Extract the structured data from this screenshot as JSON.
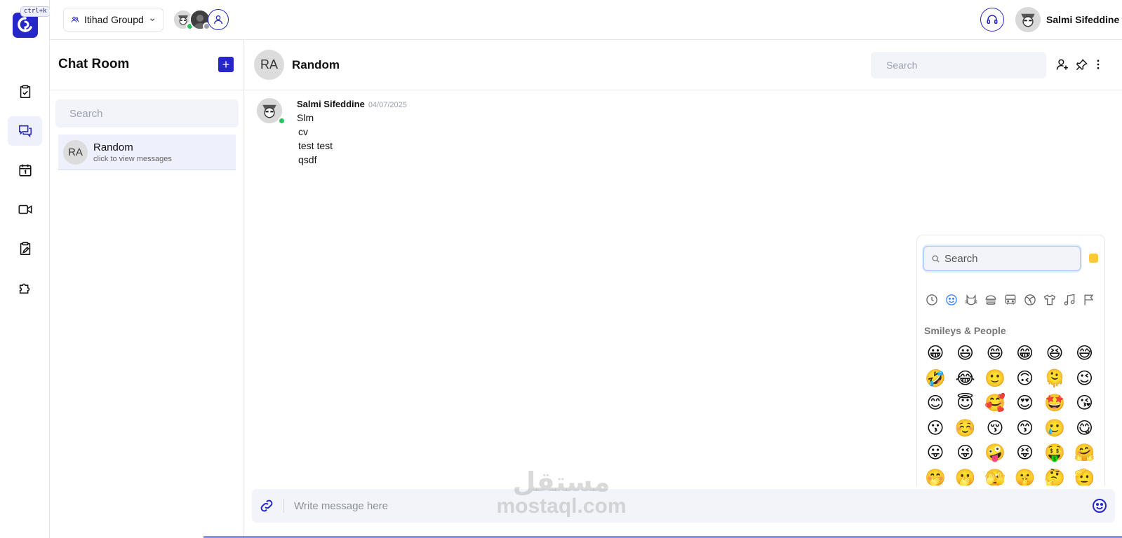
{
  "app": {
    "shortcut": "ctrl+k",
    "accent_color": "#2626c9"
  },
  "topbar": {
    "group_name": "Itihad Groupd",
    "user_name": "Salmi Sifeddine"
  },
  "sidebar": {
    "items": [
      {
        "icon": "task-check-icon",
        "active": false
      },
      {
        "icon": "chat-bubbles-icon",
        "active": true
      },
      {
        "icon": "calendar-icon",
        "active": false
      },
      {
        "icon": "video-camera-icon",
        "active": false
      },
      {
        "icon": "clipboard-edit-icon",
        "active": false
      },
      {
        "icon": "puzzle-icon",
        "active": false
      }
    ]
  },
  "chat_list": {
    "title": "Chat Room",
    "add_label": "+",
    "search_placeholder": "Search",
    "rooms": [
      {
        "initials": "RA",
        "name": "Random",
        "subtitle": "click to view messages"
      }
    ]
  },
  "chat": {
    "initials": "RA",
    "title": "Random",
    "search_placeholder": "Search",
    "messages": [
      {
        "author": "Salmi Sifeddine",
        "date": "04/07/2025",
        "lines": [
          "Slm",
          "cv",
          "test test",
          "qsdf"
        ]
      }
    ]
  },
  "emoji_picker": {
    "search_placeholder": "Search",
    "category_title": "Smileys & People",
    "categories": [
      "recent-clock-icon",
      "smiley-icon",
      "animal-cat-icon",
      "food-burger-icon",
      "travel-bus-icon",
      "activity-ball-icon",
      "objects-shirt-icon",
      "symbols-music-icon",
      "flags-icon"
    ],
    "emojis": [
      "😀",
      "😃",
      "😄",
      "😁",
      "😆",
      "😅",
      "🤣",
      "😂",
      "🙂",
      "🙃",
      "🫠",
      "😉",
      "😊",
      "😇",
      "🥰",
      "😍",
      "🤩",
      "😘",
      "😗",
      "☺️",
      "😚",
      "😙",
      "🥲",
      "😋",
      "😛",
      "😜",
      "🤪",
      "😝",
      "🤑",
      "🤗",
      "🤭",
      "🫢",
      "🫣",
      "🤫",
      "🤔",
      "🫡"
    ]
  },
  "composer": {
    "placeholder": "Write message here"
  },
  "watermark": {
    "line1": "مستقل",
    "line2": "mostaql.com"
  }
}
